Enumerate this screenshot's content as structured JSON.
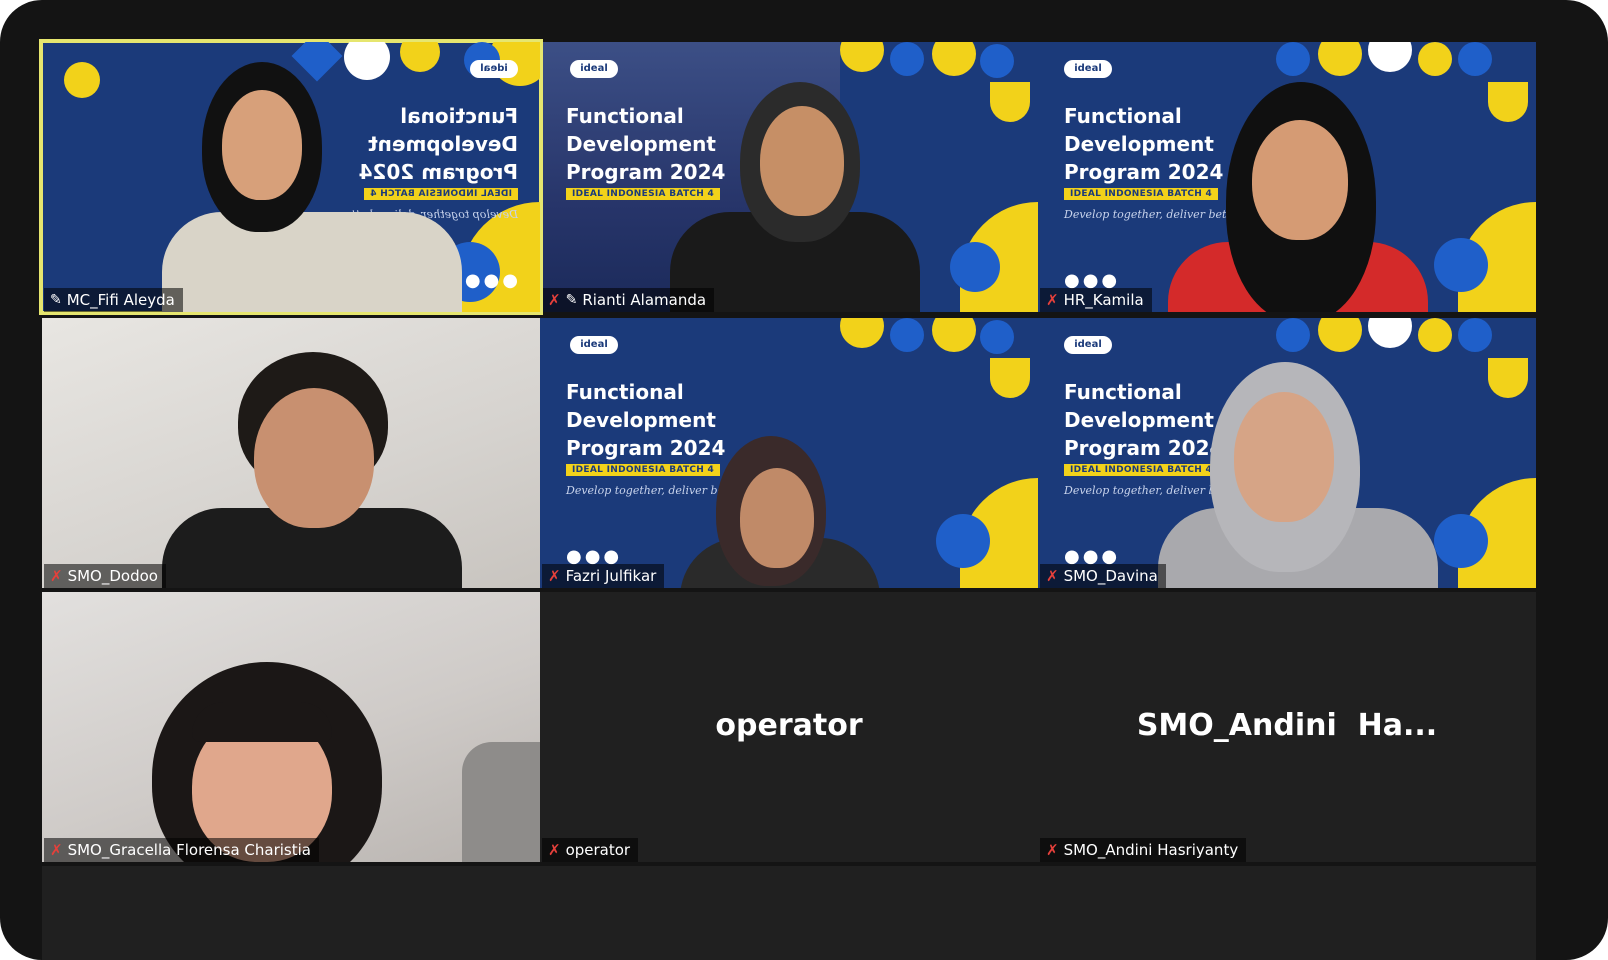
{
  "meeting": {
    "active_speaker": "MC_Fifi Aleyda",
    "tiles": [
      {
        "id": "fifi",
        "name": "MC_Fifi Aleyda",
        "pinned": true,
        "muted": false
      },
      {
        "id": "rianti",
        "name": "Rianti Alamanda",
        "pinned": true,
        "muted": true
      },
      {
        "id": "kamila",
        "name": "HR_Kamila",
        "pinned": false,
        "muted": true
      },
      {
        "id": "dodoo",
        "name": "SMO_Dodoo",
        "pinned": false,
        "muted": true
      },
      {
        "id": "fazri",
        "name": "Fazri Julfikar",
        "pinned": false,
        "muted": true
      },
      {
        "id": "davina",
        "name": "SMO_Davina",
        "pinned": false,
        "muted": true
      },
      {
        "id": "gracella",
        "name": "SMO_Gracella Florensa Charistia",
        "pinned": false,
        "muted": true
      },
      {
        "id": "operator",
        "name": "operator",
        "display_name": "operator",
        "muted": true
      },
      {
        "id": "andini",
        "name": "SMO_Andini Hasriyanty",
        "display_name": "SMO_Andini  Ha...",
        "muted": true
      }
    ]
  },
  "virtual_background": {
    "badge": "ideal",
    "title_lines": [
      "Functional",
      "Development",
      "Program 2024"
    ],
    "batch": "IDEAL INDONESIA BATCH 4",
    "tagline": "Develop together, deliver better",
    "dots": "●●●"
  },
  "icons": {
    "mic_muted": "mic-muted-icon",
    "pin": "pin-icon"
  },
  "colors": {
    "background": "#141414",
    "tile": "#202020",
    "active_outline": "#e6e66f",
    "vb_blue": "#1b3a7a",
    "vb_yellow": "#f2d21a",
    "vb_accent_blue": "#1f5fc9",
    "muted_mic": "#e5403b"
  }
}
